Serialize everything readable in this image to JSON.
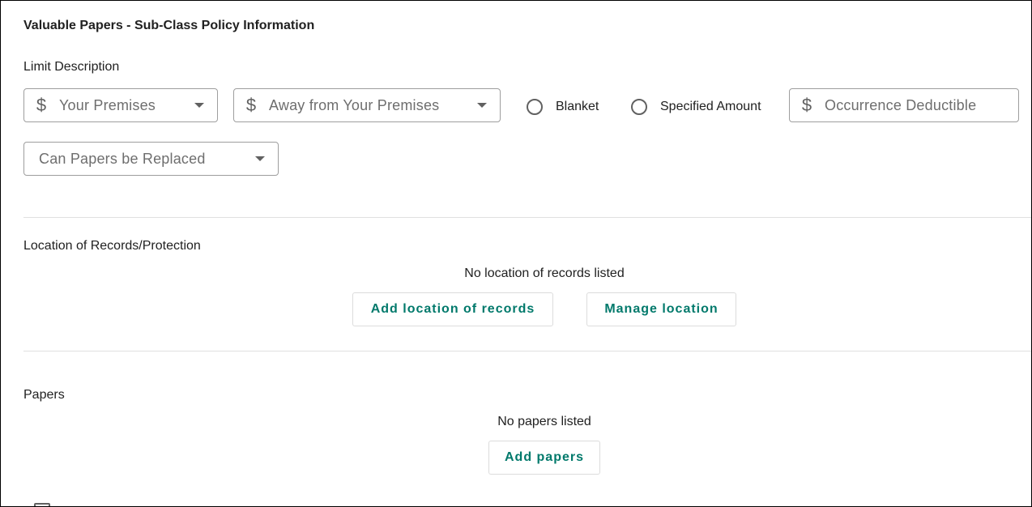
{
  "panel": {
    "title": "Valuable Papers - Sub-Class Policy Information"
  },
  "limit": {
    "section_label": "Limit Description",
    "your_premises": {
      "placeholder": "Your Premises",
      "icon": "dollar-icon"
    },
    "away_premises": {
      "placeholder": "Away from Your Premises",
      "icon": "dollar-icon"
    },
    "radio_blanket": "Blanket",
    "radio_specified": "Specified Amount",
    "deductible": {
      "placeholder": "Occurrence Deductible",
      "icon": "dollar-icon"
    },
    "papers_replaced": {
      "placeholder": "Can Papers be Replaced"
    }
  },
  "location": {
    "section_label": "Location of Records/Protection",
    "empty_text": "No location of records listed",
    "add_button": "Add location of records",
    "manage_button": "Manage location"
  },
  "papers": {
    "section_label": "Papers",
    "empty_text": "No papers listed",
    "add_button": "Add papers"
  },
  "colors": {
    "accent": "#00796b",
    "border": "#9e9e9e",
    "divider": "#e0e0e0"
  }
}
